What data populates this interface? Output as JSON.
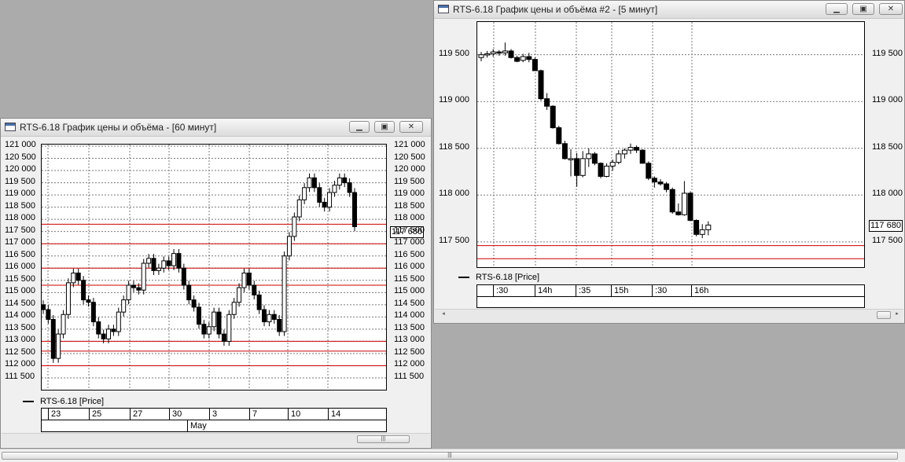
{
  "colors": {
    "desktop": "#ababab",
    "support_line": "#cc0000",
    "grid": "#7a7a7a",
    "candle": "#000000"
  },
  "win1": {
    "title": "RTS-6.18 График цены и объёма - [60 минут]",
    "y_labels": [
      "121 000",
      "120 500",
      "120 000",
      "119 500",
      "119 000",
      "118 500",
      "118 000",
      "117 500",
      "117 000",
      "116 500",
      "116 000",
      "115 500",
      "115 000",
      "114 500",
      "114 000",
      "113 500",
      "113 000",
      "112 500",
      "112 000",
      "111 500"
    ],
    "right_labels": [
      "121 000",
      "120 500",
      "120 000",
      "119 500",
      "119 000",
      "118 500",
      "118 000",
      "117 500",
      "117 000",
      "116 500",
      "116 000",
      "115 500",
      "115 000",
      "114 500",
      "114 000",
      "113 500",
      "113 000",
      "112 500",
      "112 000",
      "111 500"
    ],
    "last_price": "117 680",
    "legend": "RTS-6.18 [Price]",
    "day_ticks": [
      "23",
      "25",
      "27",
      "30",
      "3",
      "7",
      "10",
      "14"
    ],
    "month_label": "May",
    "icons": [
      "chart-window-icon",
      "minimize-icon",
      "maximize-icon",
      "close-icon",
      "scroll-grip-icon"
    ]
  },
  "win2": {
    "title": "RTS-6.18 График цены и объёма #2 - [5 минут]",
    "y_labels": [
      "119 500",
      "119 000",
      "118 500",
      "118 000",
      "117 500"
    ],
    "right_labels": [
      "119 500",
      "119 000",
      "118 500",
      "118 000",
      "117 500"
    ],
    "last_price": "117 680",
    "legend": "RTS-6.18 [Price]",
    "time_ticks": [
      ":30",
      "14h",
      ":35",
      "15h",
      ":30",
      "16h"
    ],
    "icons": [
      "chart-window-icon",
      "minimize-icon",
      "maximize-icon",
      "close-icon",
      "scroll-left-icon",
      "scroll-right-icon"
    ]
  },
  "chart_data": [
    {
      "type": "candlestick",
      "title": "RTS-6.18 График цены и объёма - [60 минут]",
      "series": [
        {
          "name": "RTS-6.18 [Price]",
          "values": [
            114300,
            113900,
            112300,
            113300,
            114100,
            115400,
            115800,
            115500,
            114700,
            114600,
            113800,
            113300,
            113100,
            113500,
            113400,
            114200,
            114700,
            115300,
            115200,
            115100,
            116200,
            116400,
            115900,
            116000,
            116300,
            116100,
            116600,
            116000,
            115300,
            114700,
            114400,
            113700,
            113300,
            113600,
            114200,
            113300,
            113000,
            114100,
            114600,
            115200,
            115800,
            115300,
            114900,
            114300,
            113800,
            114100,
            113900,
            113400,
            116500,
            117300,
            118100,
            118800,
            119300,
            119700,
            119300,
            118700,
            118500,
            119100,
            119400,
            119700,
            119500,
            119100,
            117700
          ]
        }
      ],
      "ylim": [
        111500,
        121000
      ],
      "support_levels": [
        117800,
        117000,
        116000,
        115300,
        113000,
        112600,
        112000
      ],
      "x_ticks": [
        "23",
        "25",
        "27",
        "30",
        "3",
        "7",
        "10",
        "14"
      ],
      "x_group_label": "May",
      "last_value": 117680
    },
    {
      "type": "candlestick",
      "title": "RTS-6.18 График цены и объёма #2 - [5 минут]",
      "candles": [
        [
          119470,
          119530,
          119430,
          119500
        ],
        [
          119500,
          119540,
          119470,
          119510
        ],
        [
          119510,
          119560,
          119480,
          119530
        ],
        [
          119530,
          119550,
          119490,
          119520
        ],
        [
          119520,
          119630,
          119490,
          119540
        ],
        [
          119540,
          119560,
          119460,
          119470
        ],
        [
          119470,
          119490,
          119420,
          119430
        ],
        [
          119440,
          119510,
          119420,
          119480
        ],
        [
          119480,
          119520,
          119420,
          119450
        ],
        [
          119450,
          119470,
          119330,
          119330
        ],
        [
          119330,
          119340,
          119010,
          119030
        ],
        [
          119030,
          119090,
          118910,
          118950
        ],
        [
          118950,
          118960,
          118710,
          118720
        ],
        [
          118720,
          118740,
          118540,
          118550
        ],
        [
          118550,
          118580,
          118380,
          118390
        ],
        [
          118390,
          118490,
          118200,
          118390
        ],
        [
          118390,
          118450,
          118090,
          118210
        ],
        [
          118210,
          118470,
          118190,
          118390
        ],
        [
          118390,
          118500,
          118300,
          118440
        ],
        [
          118440,
          118460,
          118320,
          118340
        ],
        [
          118340,
          118350,
          118180,
          118200
        ],
        [
          118200,
          118340,
          118190,
          118310
        ],
        [
          118310,
          118380,
          118260,
          118350
        ],
        [
          118350,
          118480,
          118330,
          118440
        ],
        [
          118440,
          118500,
          118390,
          118480
        ],
        [
          118480,
          118550,
          118440,
          118510
        ],
        [
          118510,
          118530,
          118450,
          118480
        ],
        [
          118480,
          118490,
          118350,
          118340
        ],
        [
          118340,
          118360,
          118160,
          118180
        ],
        [
          118180,
          118200,
          118080,
          118140
        ],
        [
          118140,
          118170,
          118100,
          118120
        ],
        [
          118120,
          118140,
          118030,
          118060
        ],
        [
          118060,
          118080,
          117800,
          117820
        ],
        [
          117820,
          117910,
          117780,
          117790
        ],
        [
          117790,
          118150,
          117780,
          118020
        ],
        [
          118020,
          118040,
          117720,
          117730
        ],
        [
          117730,
          117740,
          117560,
          117580
        ],
        [
          117580,
          117690,
          117540,
          117630
        ],
        [
          117630,
          117720,
          117570,
          117680
        ]
      ],
      "ylim": [
        117230,
        119850
      ],
      "support_levels": [
        117460,
        117320
      ],
      "x_ticks": [
        ":30",
        "14h",
        ":35",
        "15h",
        ":30",
        "16h"
      ],
      "last_value": 117680
    }
  ]
}
